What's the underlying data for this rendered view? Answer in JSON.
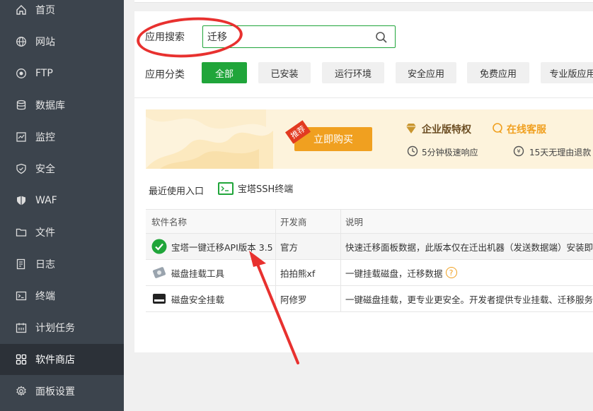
{
  "sidebar": {
    "items": [
      {
        "label": "首页",
        "icon": "home-icon"
      },
      {
        "label": "网站",
        "icon": "globe-icon"
      },
      {
        "label": "FTP",
        "icon": "ftp-icon"
      },
      {
        "label": "数据库",
        "icon": "database-icon"
      },
      {
        "label": "监控",
        "icon": "monitor-icon"
      },
      {
        "label": "安全",
        "icon": "shield-icon"
      },
      {
        "label": "WAF",
        "icon": "waf-icon"
      },
      {
        "label": "文件",
        "icon": "folder-icon"
      },
      {
        "label": "日志",
        "icon": "log-icon"
      },
      {
        "label": "终端",
        "icon": "terminal-icon"
      },
      {
        "label": "计划任务",
        "icon": "calendar-icon"
      },
      {
        "label": "软件商店",
        "icon": "grid-icon",
        "active": true
      },
      {
        "label": "面板设置",
        "icon": "gear-icon"
      }
    ]
  },
  "search": {
    "label": "应用搜索",
    "value": "迁移"
  },
  "categories": {
    "label": "应用分类",
    "items": [
      "全部",
      "已安装",
      "运行环境",
      "安全应用",
      "免费应用",
      "专业版应用"
    ]
  },
  "banner": {
    "tag": "推荐",
    "buy_label": "立即购买",
    "enterprise": "企业版特权",
    "service": "在线客服",
    "response": "5分钟极速响应",
    "refund": "15天无理由退款"
  },
  "recent": {
    "label": "最近使用入口",
    "item": "宝塔SSH终端"
  },
  "table": {
    "headers": [
      "软件名称",
      "开发商",
      "说明"
    ],
    "rows": [
      {
        "name": "宝塔一键迁移API版本 3.5",
        "dev": "官方",
        "desc": "快速迁移面板数据，此版本仅在迁出机器（发送数据端）安装即可",
        "icon": "check-circle-icon"
      },
      {
        "name": "磁盘挂载工具",
        "dev": "拍拍熊xf",
        "desc": "一键挂载磁盘，迁移数据",
        "icon": "disk-icon"
      },
      {
        "name": "磁盘安全挂载",
        "dev": "阿修罗",
        "desc": "一键磁盘挂载，更专业更安全。开发者提供专业挂载、迁移服务",
        "icon": "drive-icon"
      }
    ]
  },
  "colors": {
    "accent": "#20a53a",
    "sidebar": "#3c444d",
    "annotation": "#e8312f"
  }
}
